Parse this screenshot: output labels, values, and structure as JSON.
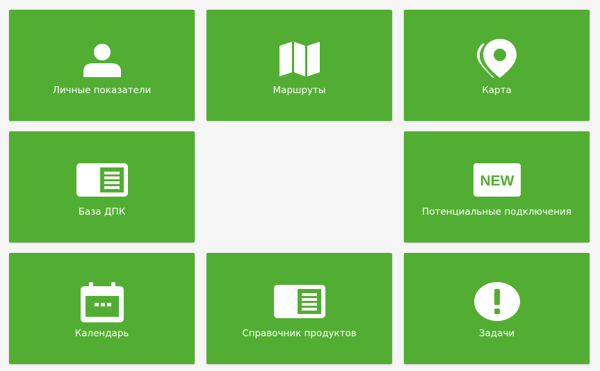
{
  "theme": {
    "background": "#f5f5f5",
    "tile_color": "#52ae32",
    "text_color": "#ffffff"
  },
  "tiles": [
    {
      "label": "Личные показатели",
      "icon": "user-icon"
    },
    {
      "label": "Маршруты",
      "icon": "map-icon"
    },
    {
      "label": "Карта",
      "icon": "map-pin-icon"
    },
    {
      "label": "База ДПК",
      "icon": "card-list-icon"
    },
    {
      "label": "Потенциальные подключения",
      "icon": "new-badge-icon",
      "badge": "NEW"
    },
    {
      "label": "Календарь",
      "icon": "calendar-icon"
    },
    {
      "label": "Справочник продуктов",
      "icon": "card-list-icon"
    },
    {
      "label": "Задачи",
      "icon": "exclamation-icon"
    }
  ]
}
